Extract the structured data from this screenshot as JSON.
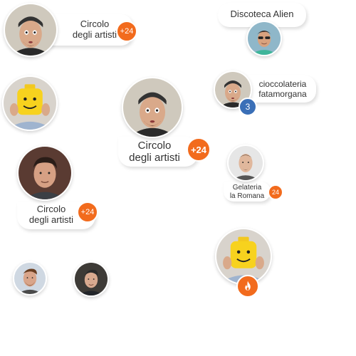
{
  "colors": {
    "accent_orange": "#f26b1d",
    "accent_blue": "#3a6fb7"
  },
  "cards": [
    {
      "label_line1": "Circolo",
      "label_line2": "degli artisti",
      "badge": "+24"
    },
    {
      "label": "Discoteca Alien"
    },
    {
      "label_line1": "cioccolateria",
      "label_line2": "fatamorgana",
      "badge": "3"
    },
    {
      "label_line1": "Circolo",
      "label_line2": "degli artisti",
      "badge": "+24"
    },
    {
      "label_line1": "Gelateria",
      "label_line2": "la Romana",
      "badge": "24"
    },
    {
      "label_line1": "Circolo",
      "label_line2": "degli artisti",
      "badge": "+24"
    },
    {
      "icon": "flame-icon"
    }
  ]
}
